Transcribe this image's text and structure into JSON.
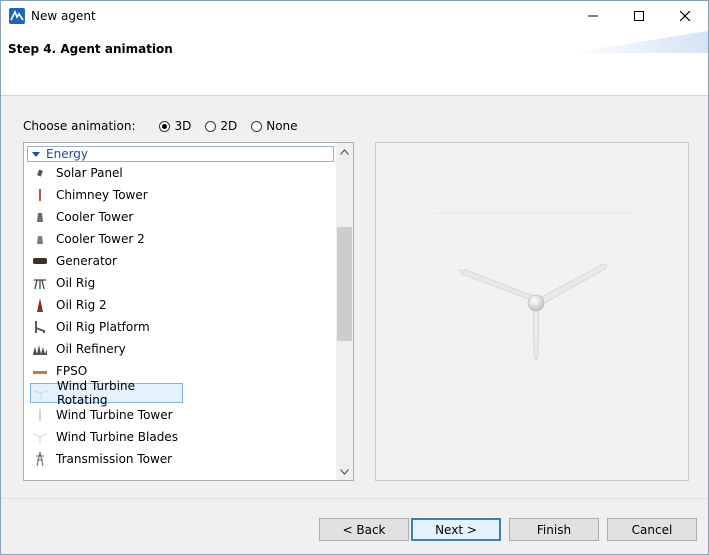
{
  "window": {
    "title": "New agent",
    "icon": "anylogic-logo-icon",
    "accent": "#1f66b5"
  },
  "header": {
    "step_title": "Step 4. Agent animation"
  },
  "animation": {
    "label": "Choose animation:",
    "options": [
      {
        "label": "3D",
        "selected": true
      },
      {
        "label": "2D",
        "selected": false
      },
      {
        "label": "None",
        "selected": false
      }
    ]
  },
  "list": {
    "group": "Energy",
    "items": [
      {
        "label": "Solar Panel",
        "icon": "solar-panel-icon"
      },
      {
        "label": "Chimney Tower",
        "icon": "chimney-tower-icon"
      },
      {
        "label": "Cooler Tower",
        "icon": "cooler-tower-icon"
      },
      {
        "label": "Cooler Tower 2",
        "icon": "cooler-tower-2-icon"
      },
      {
        "label": "Generator",
        "icon": "generator-icon"
      },
      {
        "label": "Oil Rig",
        "icon": "oil-rig-icon"
      },
      {
        "label": "Oil Rig 2",
        "icon": "oil-rig-2-icon"
      },
      {
        "label": "Oil Rig Platform",
        "icon": "oil-rig-platform-icon"
      },
      {
        "label": "Oil Refinery",
        "icon": "oil-refinery-icon"
      },
      {
        "label": "FPSO",
        "icon": "fpso-icon"
      },
      {
        "label": "Wind Turbine Rotating",
        "icon": "wind-turbine-rotating-icon",
        "selected": true
      },
      {
        "label": "Wind Turbine Tower",
        "icon": "wind-turbine-tower-icon"
      },
      {
        "label": "Wind Turbine Blades",
        "icon": "wind-turbine-blades-icon"
      },
      {
        "label": "Transmission Tower",
        "icon": "transmission-tower-icon"
      }
    ]
  },
  "buttons": {
    "back": "< Back",
    "next": "Next >",
    "finish": "Finish",
    "cancel": "Cancel"
  }
}
